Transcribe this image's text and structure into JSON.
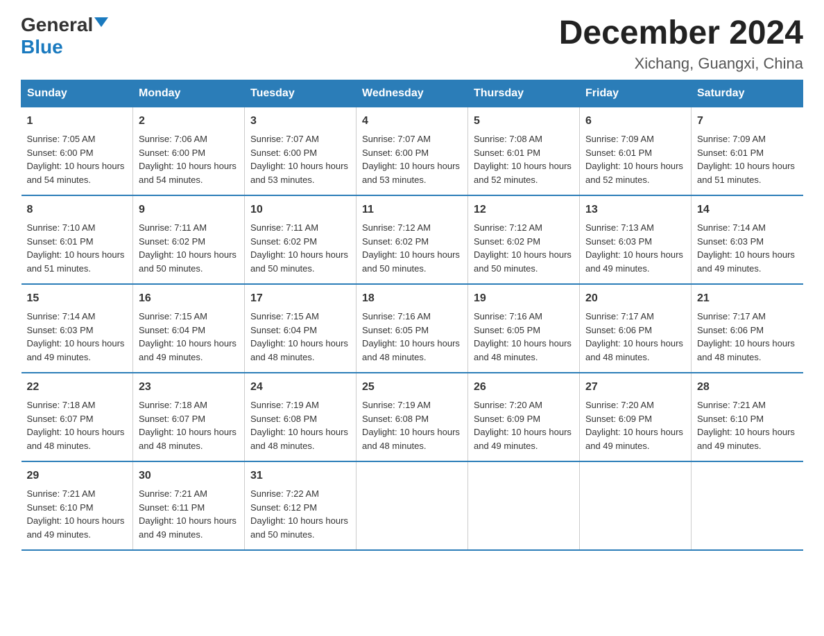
{
  "header": {
    "logo_general": "General",
    "logo_blue": "Blue",
    "month_year": "December 2024",
    "location": "Xichang, Guangxi, China"
  },
  "days_of_week": [
    "Sunday",
    "Monday",
    "Tuesday",
    "Wednesday",
    "Thursday",
    "Friday",
    "Saturday"
  ],
  "weeks": [
    [
      {
        "day": "1",
        "sunrise": "7:05 AM",
        "sunset": "6:00 PM",
        "daylight": "10 hours and 54 minutes."
      },
      {
        "day": "2",
        "sunrise": "7:06 AM",
        "sunset": "6:00 PM",
        "daylight": "10 hours and 54 minutes."
      },
      {
        "day": "3",
        "sunrise": "7:07 AM",
        "sunset": "6:00 PM",
        "daylight": "10 hours and 53 minutes."
      },
      {
        "day": "4",
        "sunrise": "7:07 AM",
        "sunset": "6:00 PM",
        "daylight": "10 hours and 53 minutes."
      },
      {
        "day": "5",
        "sunrise": "7:08 AM",
        "sunset": "6:01 PM",
        "daylight": "10 hours and 52 minutes."
      },
      {
        "day": "6",
        "sunrise": "7:09 AM",
        "sunset": "6:01 PM",
        "daylight": "10 hours and 52 minutes."
      },
      {
        "day": "7",
        "sunrise": "7:09 AM",
        "sunset": "6:01 PM",
        "daylight": "10 hours and 51 minutes."
      }
    ],
    [
      {
        "day": "8",
        "sunrise": "7:10 AM",
        "sunset": "6:01 PM",
        "daylight": "10 hours and 51 minutes."
      },
      {
        "day": "9",
        "sunrise": "7:11 AM",
        "sunset": "6:02 PM",
        "daylight": "10 hours and 50 minutes."
      },
      {
        "day": "10",
        "sunrise": "7:11 AM",
        "sunset": "6:02 PM",
        "daylight": "10 hours and 50 minutes."
      },
      {
        "day": "11",
        "sunrise": "7:12 AM",
        "sunset": "6:02 PM",
        "daylight": "10 hours and 50 minutes."
      },
      {
        "day": "12",
        "sunrise": "7:12 AM",
        "sunset": "6:02 PM",
        "daylight": "10 hours and 50 minutes."
      },
      {
        "day": "13",
        "sunrise": "7:13 AM",
        "sunset": "6:03 PM",
        "daylight": "10 hours and 49 minutes."
      },
      {
        "day": "14",
        "sunrise": "7:14 AM",
        "sunset": "6:03 PM",
        "daylight": "10 hours and 49 minutes."
      }
    ],
    [
      {
        "day": "15",
        "sunrise": "7:14 AM",
        "sunset": "6:03 PM",
        "daylight": "10 hours and 49 minutes."
      },
      {
        "day": "16",
        "sunrise": "7:15 AM",
        "sunset": "6:04 PM",
        "daylight": "10 hours and 49 minutes."
      },
      {
        "day": "17",
        "sunrise": "7:15 AM",
        "sunset": "6:04 PM",
        "daylight": "10 hours and 48 minutes."
      },
      {
        "day": "18",
        "sunrise": "7:16 AM",
        "sunset": "6:05 PM",
        "daylight": "10 hours and 48 minutes."
      },
      {
        "day": "19",
        "sunrise": "7:16 AM",
        "sunset": "6:05 PM",
        "daylight": "10 hours and 48 minutes."
      },
      {
        "day": "20",
        "sunrise": "7:17 AM",
        "sunset": "6:06 PM",
        "daylight": "10 hours and 48 minutes."
      },
      {
        "day": "21",
        "sunrise": "7:17 AM",
        "sunset": "6:06 PM",
        "daylight": "10 hours and 48 minutes."
      }
    ],
    [
      {
        "day": "22",
        "sunrise": "7:18 AM",
        "sunset": "6:07 PM",
        "daylight": "10 hours and 48 minutes."
      },
      {
        "day": "23",
        "sunrise": "7:18 AM",
        "sunset": "6:07 PM",
        "daylight": "10 hours and 48 minutes."
      },
      {
        "day": "24",
        "sunrise": "7:19 AM",
        "sunset": "6:08 PM",
        "daylight": "10 hours and 48 minutes."
      },
      {
        "day": "25",
        "sunrise": "7:19 AM",
        "sunset": "6:08 PM",
        "daylight": "10 hours and 48 minutes."
      },
      {
        "day": "26",
        "sunrise": "7:20 AM",
        "sunset": "6:09 PM",
        "daylight": "10 hours and 49 minutes."
      },
      {
        "day": "27",
        "sunrise": "7:20 AM",
        "sunset": "6:09 PM",
        "daylight": "10 hours and 49 minutes."
      },
      {
        "day": "28",
        "sunrise": "7:21 AM",
        "sunset": "6:10 PM",
        "daylight": "10 hours and 49 minutes."
      }
    ],
    [
      {
        "day": "29",
        "sunrise": "7:21 AM",
        "sunset": "6:10 PM",
        "daylight": "10 hours and 49 minutes."
      },
      {
        "day": "30",
        "sunrise": "7:21 AM",
        "sunset": "6:11 PM",
        "daylight": "10 hours and 49 minutes."
      },
      {
        "day": "31",
        "sunrise": "7:22 AM",
        "sunset": "6:12 PM",
        "daylight": "10 hours and 50 minutes."
      },
      null,
      null,
      null,
      null
    ]
  ],
  "labels": {
    "sunrise": "Sunrise:",
    "sunset": "Sunset:",
    "daylight": "Daylight:"
  }
}
